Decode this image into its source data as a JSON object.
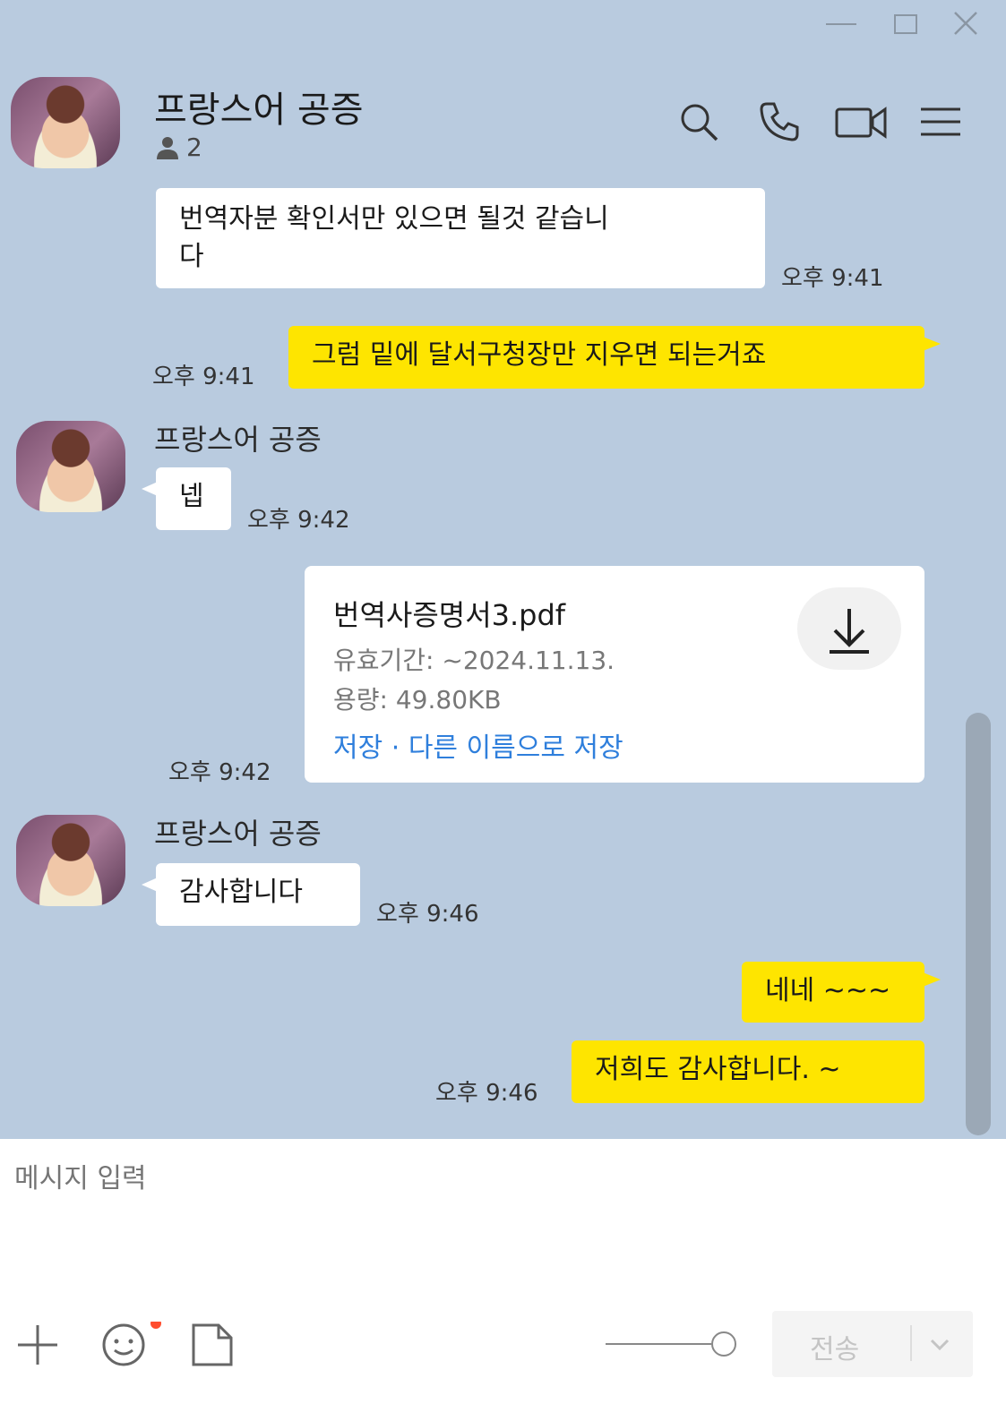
{
  "window": {
    "minimize_icon": "minimize-icon",
    "maximize_icon": "maximize-icon",
    "close_icon": "close-icon"
  },
  "header": {
    "title": "프랑스어 공증",
    "member_count": "2"
  },
  "messages": {
    "m1": {
      "line1": "번역자분 확인서만 있으면 될것 같습니",
      "line2": "다",
      "time": "오후 9:41"
    },
    "m2": {
      "text": "그럼 밑에 달서구청장만 지우면 되는거죠",
      "time": "오후 9:41"
    },
    "m3": {
      "sender": "프랑스어 공증",
      "text": "넵",
      "time": "오후 9:42"
    },
    "file": {
      "name": "번역사증명서3.pdf",
      "expiry": "유효기간: ~2024.11.13.",
      "size": "용량: 49.80KB",
      "save": "저장",
      "separator": " · ",
      "save_as": "다른 이름으로 저장",
      "time": "오후 9:42"
    },
    "m4": {
      "sender": "프랑스어 공증",
      "text": "감사합니다",
      "time": "오후 9:46"
    },
    "m5": {
      "text": "네네 ~~~"
    },
    "m6": {
      "text": "저희도 감사합니다. ~",
      "time": "오후 9:46"
    }
  },
  "composer": {
    "placeholder": "메시지 입력",
    "send_label": "전송"
  },
  "colors": {
    "background": "#b9cbdf",
    "my_bubble": "#fee500",
    "link": "#2f7fdc"
  }
}
